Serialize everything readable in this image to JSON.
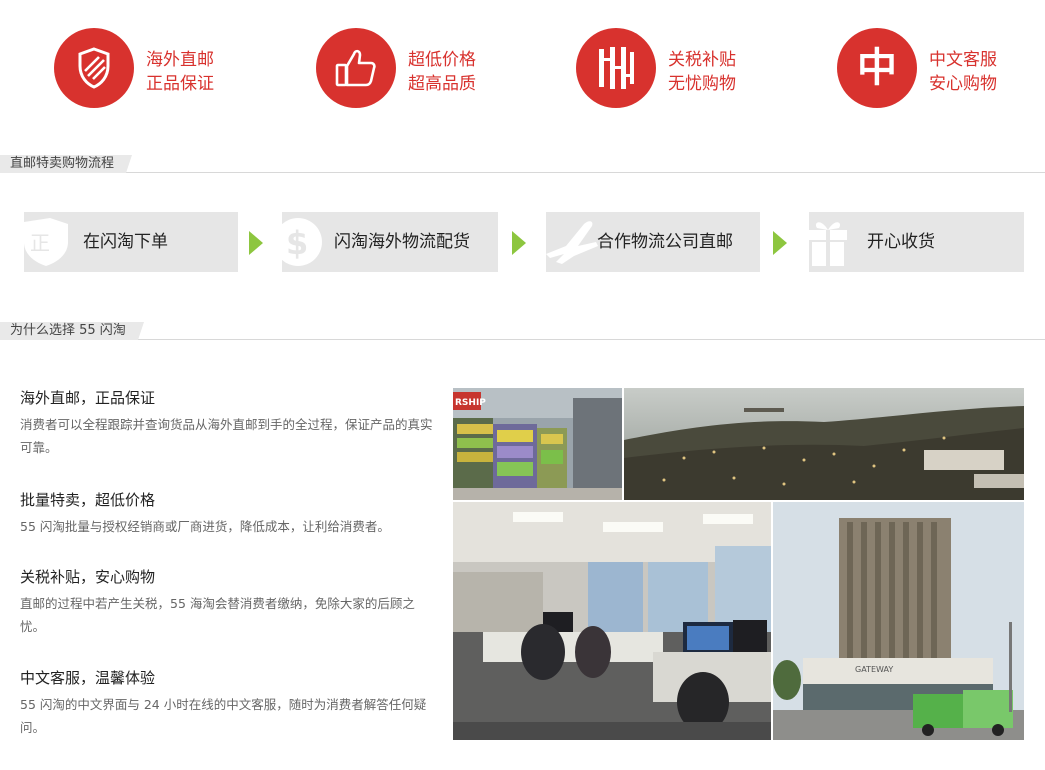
{
  "features": [
    {
      "line1": "海外直邮",
      "line2": "正品保证",
      "icon": "shield-icon"
    },
    {
      "line1": "超低价格",
      "line2": "超高品质",
      "icon": "thumbs-up-icon"
    },
    {
      "line1": "关税补贴",
      "line2": "无忧购物",
      "icon": "tax-icon"
    },
    {
      "line1": "中文客服",
      "line2": "安心购物",
      "icon": "chinese-char-icon",
      "glyph": "中"
    }
  ],
  "sections": {
    "process_title": "直邮特卖购物流程",
    "why_title": "为什么选择 55 闪淘"
  },
  "steps": [
    {
      "label": "在闪淘下单",
      "icon": "shield-icon"
    },
    {
      "label": "闪淘海外物流配货",
      "icon": "dollar-icon"
    },
    {
      "label": "合作物流公司直邮",
      "icon": "airplane-icon"
    },
    {
      "label": "开心收货",
      "icon": "gift-icon"
    }
  ],
  "reasons": [
    {
      "title": "海外直邮，正品保证",
      "desc": "消费者可以全程跟踪并查询货品从海外直邮到手的全过程，保证产品的真实可靠。"
    },
    {
      "title": "批量特卖，超低价格",
      "desc": "55 闪淘批量与授权经销商或厂商进货，降低成本，让利给消费者。"
    },
    {
      "title": "关税补贴，安心购物",
      "desc": "直邮的过程中若产生关税，55 海淘会替消费者缴纳，免除大家的后顾之忧。"
    },
    {
      "title": "中文客服，温馨体验",
      "desc": "55 闪淘的中文界面与 24 小时在线的中文客服，随时为消费者解答任何疑问。"
    }
  ],
  "photos": {
    "warehouse_sign": "RSHIP",
    "building_sign": "GATEWAY"
  },
  "colors": {
    "accent": "#d8322e",
    "arrow": "#8dc63f",
    "step_bg": "#e6e6e6"
  }
}
